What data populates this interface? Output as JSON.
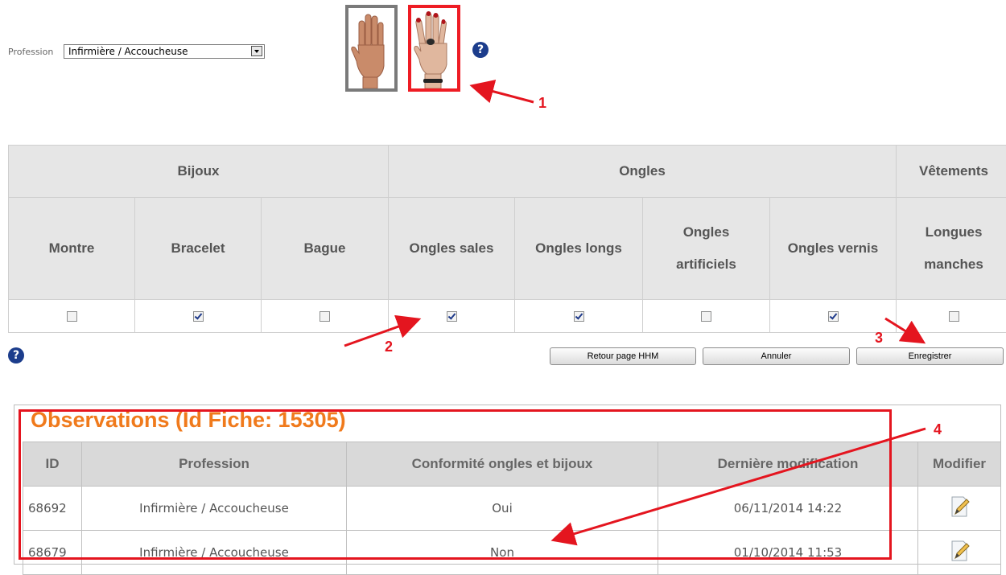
{
  "profession": {
    "label": "Profession",
    "value": "Infirmière / Accoucheuse"
  },
  "hands": {
    "bare_icon": "bare-hand-icon",
    "jewelry_icon": "hand-with-jewelry-icon"
  },
  "help_icon": "question-mark-icon",
  "criteria": {
    "groups": [
      "Bijoux",
      "Ongles",
      "Vêtements"
    ],
    "columns": [
      {
        "label": "Montre",
        "checked": false
      },
      {
        "label": "Bracelet",
        "checked": true
      },
      {
        "label": "Bague",
        "checked": false
      },
      {
        "label": "Ongles sales",
        "checked": true
      },
      {
        "label": "Ongles longs",
        "checked": true
      },
      {
        "label": "Ongles artificiels",
        "line1": "Ongles",
        "line2": "artificiels",
        "checked": false
      },
      {
        "label": "Ongles vernis",
        "checked": true
      },
      {
        "label": "Longues manches",
        "line1": "Longues",
        "line2": "manches",
        "checked": false
      }
    ]
  },
  "buttons": {
    "back": "Retour page HHM",
    "cancel": "Annuler",
    "save": "Enregistrer"
  },
  "observations": {
    "title": "Observations (Id Fiche: 15305)",
    "headers": [
      "ID",
      "Profession",
      "Conformité ongles et bijoux",
      "Dernière modification",
      "Modifier"
    ],
    "rows": [
      {
        "id": "68692",
        "profession": "Infirmière / Accoucheuse",
        "conformity": "Oui",
        "modified": "06/11/2014 14:22",
        "edit_icon": "edit-note-icon"
      },
      {
        "id": "68679",
        "profession": "Infirmière / Accoucheuse",
        "conformity": "Non",
        "modified": "01/10/2014 11:53",
        "edit_icon": "edit-note-icon"
      }
    ]
  },
  "annotations": {
    "steps": [
      "1",
      "2",
      "3",
      "4"
    ],
    "color": "#e4151f"
  },
  "colors": {
    "title_orange": "#f07a1c",
    "header_gray": "#e6e6e6",
    "help_blue": "#1c3d8c"
  }
}
